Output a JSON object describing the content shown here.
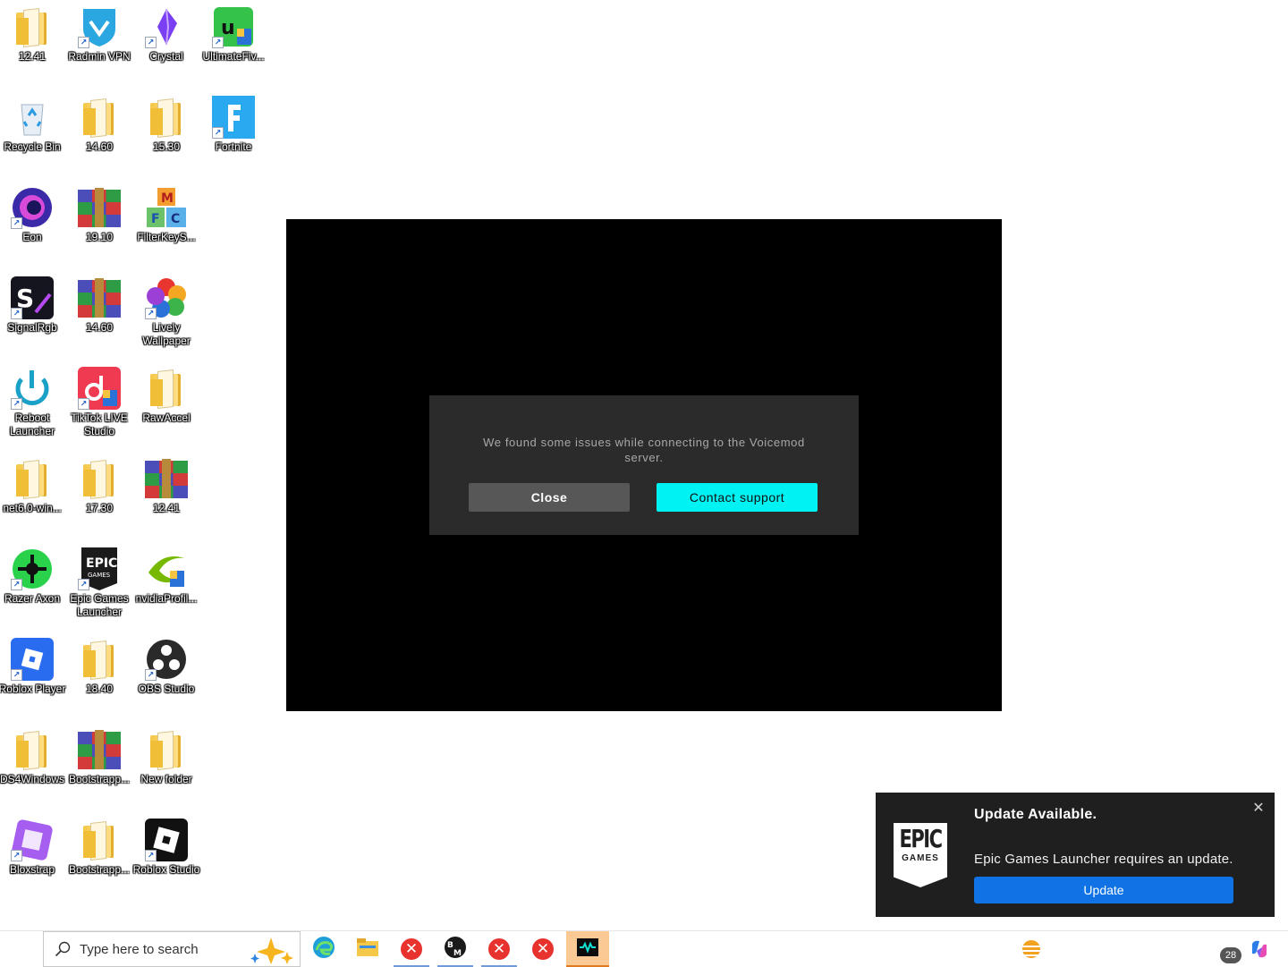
{
  "desktop": {
    "icons": [
      {
        "label": "12.41",
        "icon": "folder-icon",
        "shortcut": false
      },
      {
        "label": "Radmin VPN",
        "icon": "radmin-vpn-icon",
        "shortcut": true
      },
      {
        "label": "Crystal",
        "icon": "crystal-icon",
        "shortcut": true
      },
      {
        "label": "UltimateFiv...",
        "icon": "ultimatefiv-icon",
        "shortcut": true
      },
      {
        "label": "Recycle Bin",
        "icon": "recycle-bin-icon",
        "shortcut": false
      },
      {
        "label": "14.60",
        "icon": "folder-icon",
        "shortcut": false
      },
      {
        "label": "15.30",
        "icon": "folder-icon",
        "shortcut": false
      },
      {
        "label": "Fortnite",
        "icon": "fortnite-icon",
        "shortcut": true
      },
      {
        "label": "Eon",
        "icon": "eon-icon",
        "shortcut": true
      },
      {
        "label": "19.10",
        "icon": "winrar-archive-icon",
        "shortcut": false
      },
      {
        "label": "FilterKeyS...",
        "icon": "filterkeys-icon",
        "shortcut": false
      },
      {
        "label": "SignalRgb",
        "icon": "signalrgb-icon",
        "shortcut": true
      },
      {
        "label": "14.60",
        "icon": "winrar-archive-icon",
        "shortcut": false
      },
      {
        "label": "Lively Wallpaper",
        "icon": "lively-wallpaper-icon",
        "shortcut": true
      },
      {
        "label": "Reboot Launcher",
        "icon": "reboot-launcher-icon",
        "shortcut": true
      },
      {
        "label": "TikTok LIVE Studio",
        "icon": "tiktok-live-icon",
        "shortcut": true
      },
      {
        "label": "RawAccel",
        "icon": "folder-icon",
        "shortcut": false
      },
      {
        "label": "net6.0-win...",
        "icon": "folder-icon",
        "shortcut": false
      },
      {
        "label": "17.30",
        "icon": "folder-icon",
        "shortcut": false
      },
      {
        "label": "12.41",
        "icon": "winrar-archive-icon",
        "shortcut": false
      },
      {
        "label": "Razer Axon",
        "icon": "razer-axon-icon",
        "shortcut": true
      },
      {
        "label": "Epic Games Launcher",
        "icon": "epic-games-icon",
        "shortcut": true
      },
      {
        "label": "nvidiaProfil...",
        "icon": "nvidia-profile-icon",
        "shortcut": false
      },
      {
        "label": "Roblox Player",
        "icon": "roblox-player-icon",
        "shortcut": true
      },
      {
        "label": "18.40",
        "icon": "folder-icon",
        "shortcut": false
      },
      {
        "label": "OBS Studio",
        "icon": "obs-studio-icon",
        "shortcut": true
      },
      {
        "label": "DS4Windows",
        "icon": "folder-icon",
        "shortcut": false
      },
      {
        "label": "Bootstrapp...",
        "icon": "winrar-archive-icon",
        "shortcut": false
      },
      {
        "label": "New folder",
        "icon": "folder-icon",
        "shortcut": false
      },
      {
        "label": "Bloxstrap",
        "icon": "bloxstrap-icon",
        "shortcut": true
      },
      {
        "label": "Bootstrapp...",
        "icon": "folder-icon",
        "shortcut": false
      },
      {
        "label": "Roblox Studio",
        "icon": "roblox-studio-icon",
        "shortcut": true
      }
    ]
  },
  "app_window": {
    "dialog": {
      "message": "We found some issues while connecting to the Voicemod server.",
      "close_label": "Close",
      "support_label": "Contact support"
    }
  },
  "toast": {
    "logo_line1": "EPIC",
    "logo_line2": "GAMES",
    "title": "Update Available.",
    "body": "Epic Games Launcher requires an update.",
    "button_label": "Update",
    "close_glyph": "✕"
  },
  "taskbar": {
    "search_placeholder": "Type here to search",
    "pinned": [
      {
        "name": "edge-icon",
        "state": "none"
      },
      {
        "name": "file-explorer-icon",
        "state": "none"
      },
      {
        "name": "error-app-icon",
        "state": "running"
      },
      {
        "name": "bm-app-icon",
        "state": "running"
      },
      {
        "name": "error-app-icon",
        "state": "running"
      },
      {
        "name": "error-app-icon",
        "state": "none"
      },
      {
        "name": "voicemod-icon",
        "state": "active"
      }
    ],
    "tray_badge": "28",
    "accent_colors": {
      "cyan": "#00f2f2",
      "update_blue": "#0f73e6",
      "active_task": "#fbc993"
    }
  }
}
